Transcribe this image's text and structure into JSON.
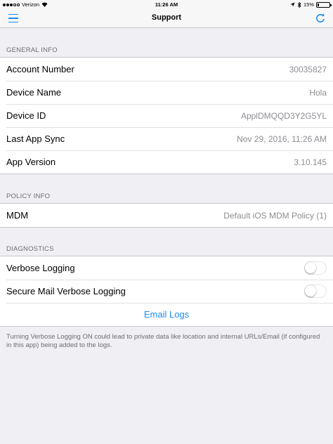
{
  "status_bar": {
    "carrier": "Verizon",
    "time": "11:26 AM",
    "battery_text": "15%",
    "battery_level": 0.15,
    "signal_bars": 3,
    "signal_total": 5,
    "icons": [
      "wifi-icon",
      "location-icon",
      "bluetooth-icon",
      "battery-icon"
    ]
  },
  "nav": {
    "title": "Support",
    "left_icon": "hamburger-menu-icon",
    "right_icon": "refresh-icon"
  },
  "general_info": {
    "header": "GENERAL INFO",
    "rows": [
      {
        "label": "Account Number",
        "value": "30035827"
      },
      {
        "label": "Device Name",
        "value": "Hola"
      },
      {
        "label": "Device ID",
        "value": "ApplDMQQD3Y2G5YL"
      },
      {
        "label": "Last App Sync",
        "value": "Nov 29, 2016, 11:26 AM"
      },
      {
        "label": "App Version",
        "value": "3.10.145"
      }
    ]
  },
  "policy_info": {
    "header": "POLICY INFO",
    "rows": [
      {
        "label": "MDM",
        "value": "Default iOS MDM Policy (1)"
      }
    ]
  },
  "diagnostics": {
    "header": "DIAGNOSTICS",
    "toggles": [
      {
        "label": "Verbose Logging",
        "on": false
      },
      {
        "label": "Secure Mail Verbose Logging",
        "on": false
      }
    ],
    "email_logs_label": "Email Logs",
    "footer": "Turning Verbose Logging ON could lead to private data like location and internal URLs/Email (if configured in this app) being added to the logs."
  },
  "colors": {
    "accent": "#1a8cf0",
    "background": "#efeff4",
    "secondary_text": "#8e8e93",
    "section_header_text": "#6d6d72"
  }
}
